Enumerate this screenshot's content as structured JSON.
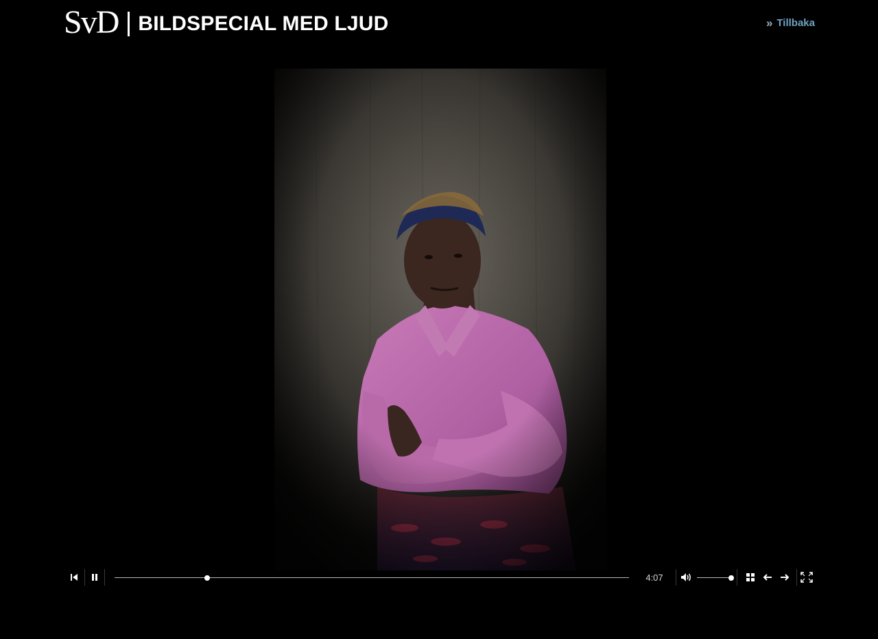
{
  "header": {
    "logo": "SvD",
    "section_title": "BILDSPECIAL MED LJUD",
    "back_label": "Tillbaka"
  },
  "photo": {
    "subject": "portrait-photo"
  },
  "player": {
    "time": "4:07",
    "progress_fraction": 0.18,
    "volume_fraction": 1.0
  },
  "colors": {
    "background": "#000000",
    "link": "#6fa3c2",
    "track": "#b7b7b7"
  },
  "icons": {
    "prev": "skip-back-icon",
    "pause": "pause-icon",
    "volume": "volume-icon",
    "grid": "grid-icon",
    "prev_image": "arrow-left-icon",
    "next_image": "arrow-right-icon",
    "fullscreen": "fullscreen-icon"
  }
}
